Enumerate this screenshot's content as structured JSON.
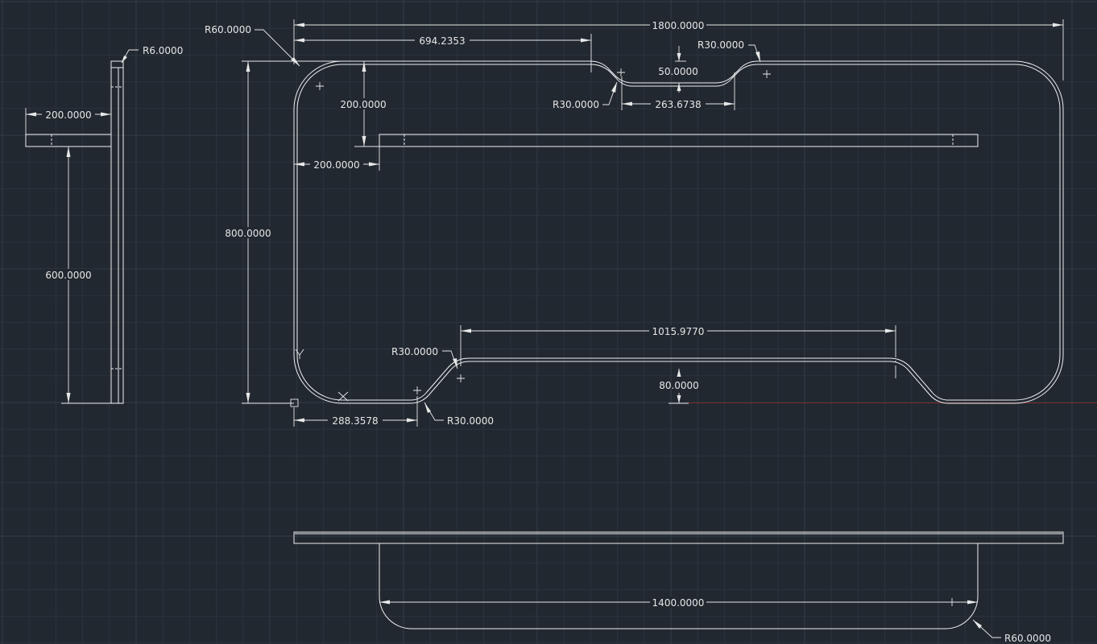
{
  "drawing": {
    "dimensions": {
      "overall_width": "1800.0000",
      "top_offset": "694.2353",
      "top_left_radius": "R60.0000",
      "notch_right_radius": "R30.0000",
      "notch_depth": "50.0000",
      "notch_left_radius": "R30.0000",
      "notch_width": "263.6738",
      "upper_vertical": "200.0000",
      "upper_horizontal": "200.0000",
      "total_height": "800.0000",
      "bottom_width": "1015.9770",
      "bottom_upper_radius": "R30.0000",
      "bottom_depth": "80.0000",
      "bottom_offset": "288.3578",
      "bottom_lower_radius": "R30.0000",
      "side_width": "200.0000",
      "side_radius": "R6.0000",
      "side_height": "600.0000",
      "front_width": "1400.0000",
      "front_radius": "R60.0000"
    },
    "ucs": {
      "y_label": "Y",
      "x_label": "X"
    },
    "colors": {
      "background": "#212830",
      "geometry": "#f0f0f0",
      "x_axis": "#7a2a2a"
    }
  }
}
